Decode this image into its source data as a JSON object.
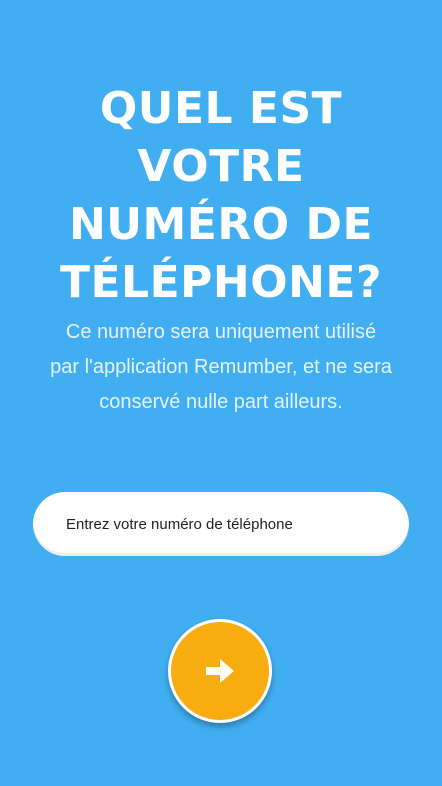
{
  "screen": {
    "title_lines": [
      "QUEL EST",
      "VOTRE",
      "NUMÉRO DE",
      "TÉLÉPHONE?"
    ],
    "subtitle_lines": [
      "Ce numéro sera uniquement utilisé",
      "par l'application Remumber, et ne sera",
      "conservé nulle part ailleurs."
    ]
  },
  "phone_input": {
    "placeholder": "Entrez votre numéro de téléphone",
    "value": ""
  },
  "next_button": {
    "icon": "arrow-right-icon"
  },
  "colors": {
    "background": "#40aef0",
    "button": "#f7ac0f",
    "input_background": "#ffffff",
    "text": "#ffffff"
  }
}
